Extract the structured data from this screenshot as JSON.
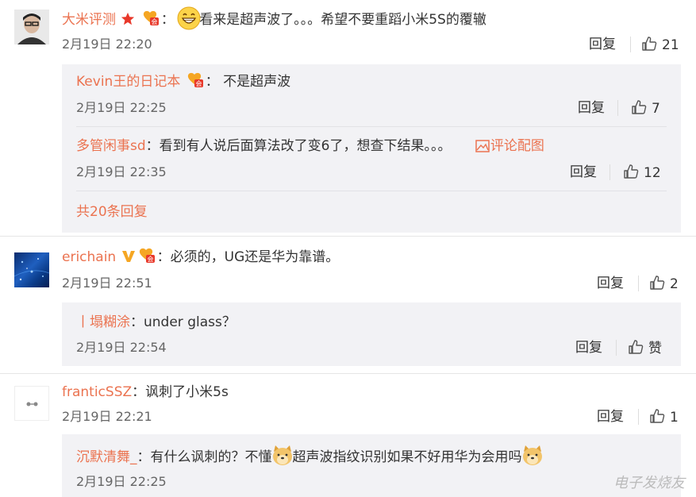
{
  "comments": [
    {
      "user": "大米评测",
      "text": "看来是超声波了。。。希望不要重蹈小米5S的覆辙",
      "time": "2月19日 22:20",
      "reply_label": "回复",
      "likes": "21",
      "replies": [
        {
          "user": "Kevin王的日记本",
          "text": "不是超声波",
          "time": "2月19日 22:25",
          "reply_label": "回复",
          "likes": "7"
        },
        {
          "user": "多管闲事sd",
          "text": "看到有人说后面算法改了变6了，想查下结果。。。",
          "image_link": "评论配图",
          "time": "2月19日 22:35",
          "reply_label": "回复",
          "likes": "12"
        }
      ],
      "more": "共20条回复"
    },
    {
      "user": "erichain",
      "text": "必须的，UG还是华为靠谱。",
      "time": "2月19日 22:51",
      "reply_label": "回复",
      "likes": "2",
      "replies": [
        {
          "user": "塌糊涂",
          "text": "under glass？",
          "time": "2月19日 22:54",
          "reply_label": "回复",
          "likes": "赞"
        }
      ]
    },
    {
      "user": "franticSSZ",
      "text": "讽刺了小米5s",
      "time": "2月19日 22:21",
      "reply_label": "回复",
      "likes": "1",
      "replies": [
        {
          "user": "沉默清舞_",
          "text_a": "有什么讽刺的？不懂",
          "text_b": "超声波指纹识别如果不好用华为会用吗",
          "time": "2月19日 22:25"
        }
      ]
    }
  ],
  "colon": "：",
  "reply_prefix": "丨",
  "watermark": "电子发烧友",
  "colors": {
    "username": "#eb7350",
    "reply_bg": "#f2f2f5"
  }
}
